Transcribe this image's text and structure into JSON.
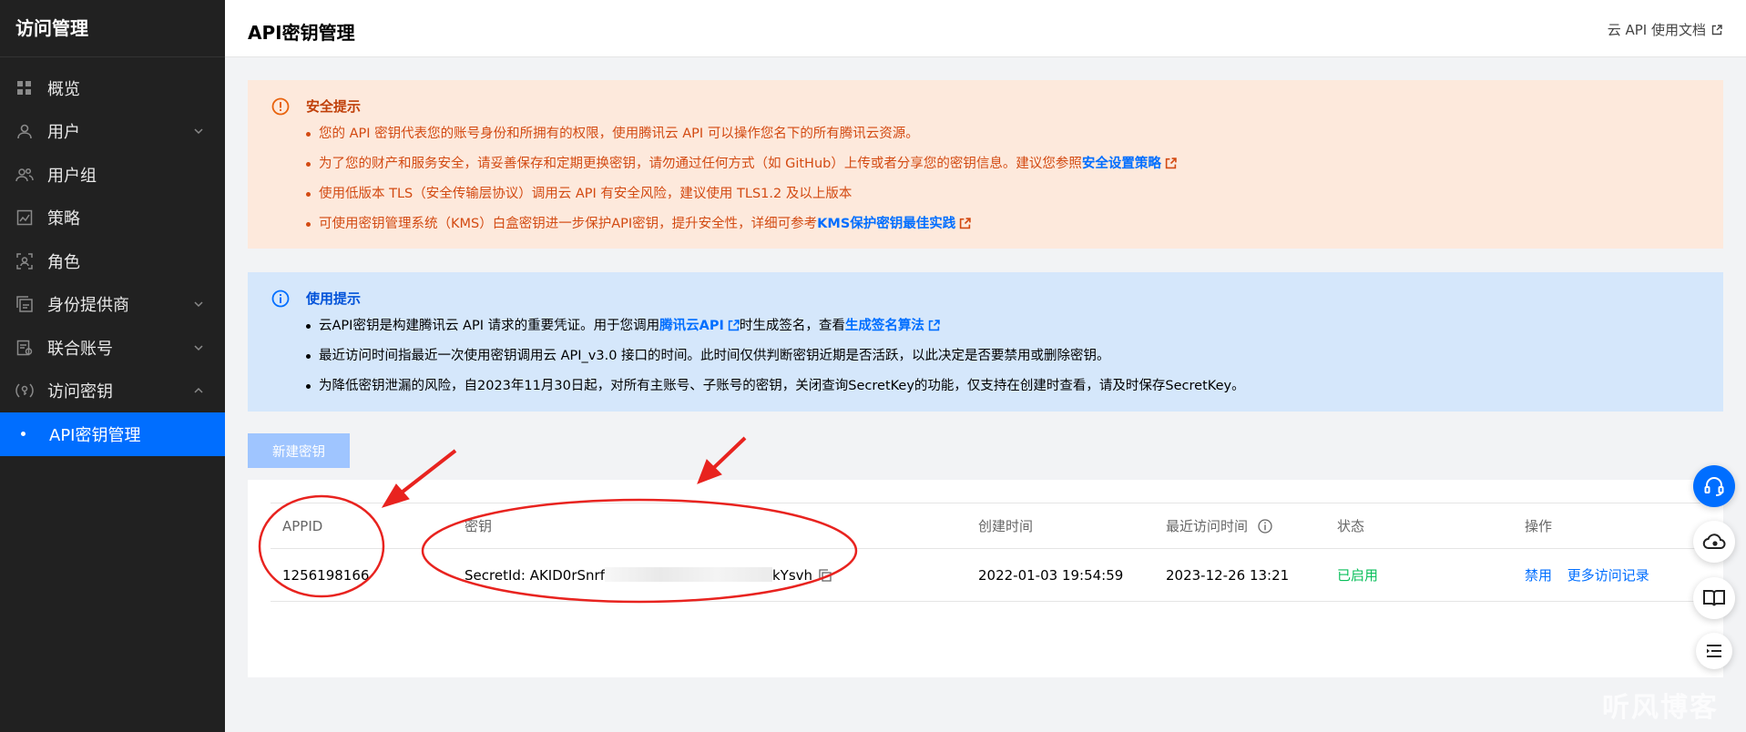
{
  "sidebar": {
    "title": "访问管理",
    "items": [
      {
        "label": "概览"
      },
      {
        "label": "用户"
      },
      {
        "label": "用户组"
      },
      {
        "label": "策略"
      },
      {
        "label": "角色"
      },
      {
        "label": "身份提供商"
      },
      {
        "label": "联合账号"
      },
      {
        "label": "访问密钥"
      },
      {
        "label": "API密钥管理"
      }
    ]
  },
  "header": {
    "title": "API密钥管理",
    "doc_link": "云 API 使用文档"
  },
  "warning": {
    "title": "安全提示",
    "lines": [
      "您的 API 密钥代表您的账号身份和所拥有的权限，使用腾讯云 API 可以操作您名下的所有腾讯云资源。",
      "为了您的财产和服务安全，请妥善保存和定期更换密钥，请勿通过任何方式（如 GitHub）上传或者分享您的密钥信息。建议您参照",
      "使用低版本 TLS（安全传输层协议）调用云 API 有安全风险，建议使用 TLS1.2 及以上版本",
      "可使用密钥管理系统（KMS）白盒密钥进一步保护API密钥，提升安全性，详细可参考"
    ],
    "link1": "安全设置策略",
    "link2": "KMS保护密钥最佳实践"
  },
  "info": {
    "title": "使用提示",
    "line1_a": "云API密钥是构建腾讯云 API 请求的重要凭证。用于您调用",
    "line1_link1": "腾讯云API",
    "line1_b": "时生成签名，查看",
    "line1_link2": "生成签名算法",
    "line2": "最近访问时间指最近一次使用密钥调用云 API_v3.0 接口的时间。此时间仅供判断密钥近期是否活跃，以此决定是否要禁用或删除密钥。",
    "line3": "为降低密钥泄漏的风险，自2023年11月30日起，对所有主账号、子账号的密钥，关闭查询SecretKey的功能，仅支持在创建时查看，请及时保存SecretKey。"
  },
  "create_button": "新建密钥",
  "table": {
    "headers": [
      "APPID",
      "密钥",
      "创建时间",
      "最近访问时间",
      "状态",
      "操作"
    ],
    "rows": [
      {
        "appid": "1256198166",
        "secret_prefix": "SecretId: AKID0rSnrf",
        "secret_suffix": "kYsvh",
        "created": "2022-01-03 19:54:59",
        "last_access": "2023-12-26 13:21",
        "status": "已启用",
        "action1": "禁用",
        "action2": "更多访问记录"
      }
    ]
  },
  "watermark": "听风博客",
  "colors": {
    "sidebar_bg": "#212121",
    "active": "#006eff",
    "warn_bg": "#fde9dc",
    "info_bg": "#d5e7fb",
    "status_ok": "#0abf5b",
    "annotation": "#e8231f"
  }
}
